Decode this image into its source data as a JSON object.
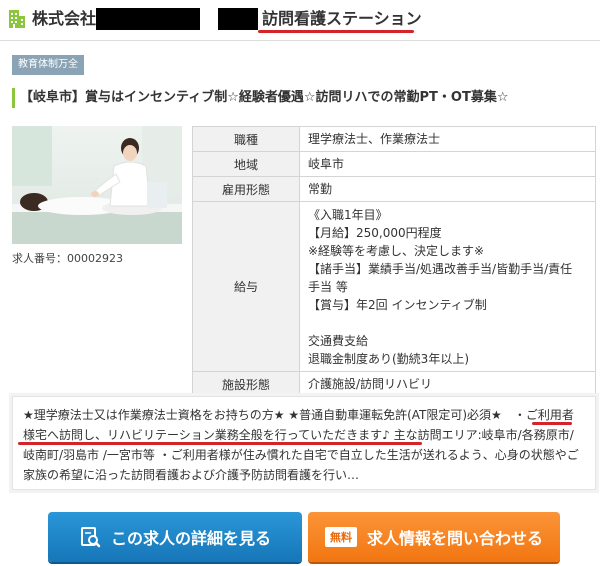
{
  "header": {
    "company_prefix": "株式会社",
    "station_name": "訪問看護ステーション"
  },
  "badge": "教育体制万全",
  "job_title": "【岐阜市】賞与はインセンティブ制☆経験者優遇☆訪問リハでの常勤PT・OT募集☆",
  "job_number": "求人番号：00002923",
  "table": {
    "rows": [
      {
        "label": "職種",
        "value": "理学療法士、作業療法士"
      },
      {
        "label": "地域",
        "value": "岐阜市"
      },
      {
        "label": "雇用形態",
        "value": "常勤"
      }
    ],
    "salary_label": "給与",
    "salary_lines": [
      "《入職1年目》",
      "【月給】250,000円程度",
      "※経験等を考慮し、決定します※",
      "【諸手当】業績手当/処遇改善手当/皆勤手当/責任",
      "手当 等",
      "【賞与】年2回 インセンティブ制",
      "",
      "交通費支給",
      "退職金制度あり(勤続3年以上)"
    ],
    "facility_label": "施設形態",
    "facility_value": "介護施設/訪問リハビリ"
  },
  "description": "★理学療法士又は作業療法士資格をお持ちの方★ ★普通自動車運転免許(AT限定可)必須★　・ご利用者様宅へ訪問し、リハビリテーション業務全般を行っていただきます♪ 主な訪問エリア:岐阜市/各務原市/岐南町/羽島市 /一宮市等 ・ご利用者様が住み慣れた自宅で自立した生活が送れるよう、心身の状態やご家族の希望に沿った訪問看護および介護予防訪問看護を行い…",
  "buttons": {
    "detail_label": "この求人の詳細を見る",
    "free_tag": "無料",
    "contact_label": "求人情報を問い合わせる"
  },
  "colors": {
    "accent_red": "#d4232b",
    "title_green": "#8cc63f",
    "detail_blue": "#1a82c6",
    "contact_orange": "#f5821f",
    "badge_gray_blue": "#8aa3b5"
  },
  "icons": {
    "header": "building-icon",
    "detail_button": "document-search-icon"
  }
}
